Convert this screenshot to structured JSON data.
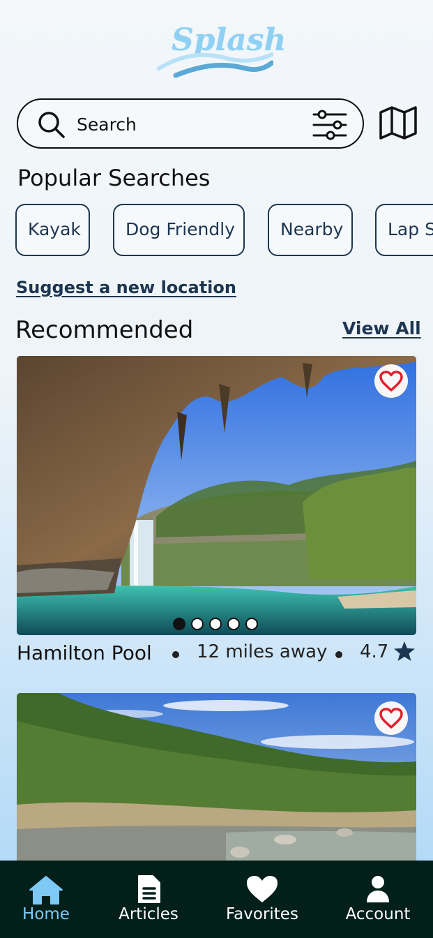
{
  "app": {
    "logo_text": "Splash"
  },
  "search": {
    "placeholder": "Search"
  },
  "popular": {
    "title": "Popular Searches",
    "chips": [
      "Kayak",
      "Dog Friendly",
      "Nearby",
      "Lap Swimming"
    ]
  },
  "suggest_link": "Suggest a new location",
  "recommended": {
    "title": "Recommended",
    "view_all": "View All",
    "cards": [
      {
        "name": "Hamilton Pool",
        "distance": "12 miles away",
        "rating": "4.7",
        "image_count": 5,
        "active_image": 1,
        "favorite": false
      },
      {
        "name": "",
        "distance": "",
        "rating": "",
        "favorite": false
      }
    ]
  },
  "nav": {
    "items": [
      {
        "label": "Home",
        "icon": "home-icon",
        "active": true
      },
      {
        "label": "Articles",
        "icon": "document-icon",
        "active": false
      },
      {
        "label": "Favorites",
        "icon": "heart-icon",
        "active": false
      },
      {
        "label": "Account",
        "icon": "user-icon",
        "active": false
      }
    ]
  },
  "colors": {
    "accent": "#1d3550",
    "nav_bg": "#021f1a",
    "nav_active": "#7ec9f5",
    "heart": "#e0202e",
    "logo": "#8fd0f3"
  }
}
